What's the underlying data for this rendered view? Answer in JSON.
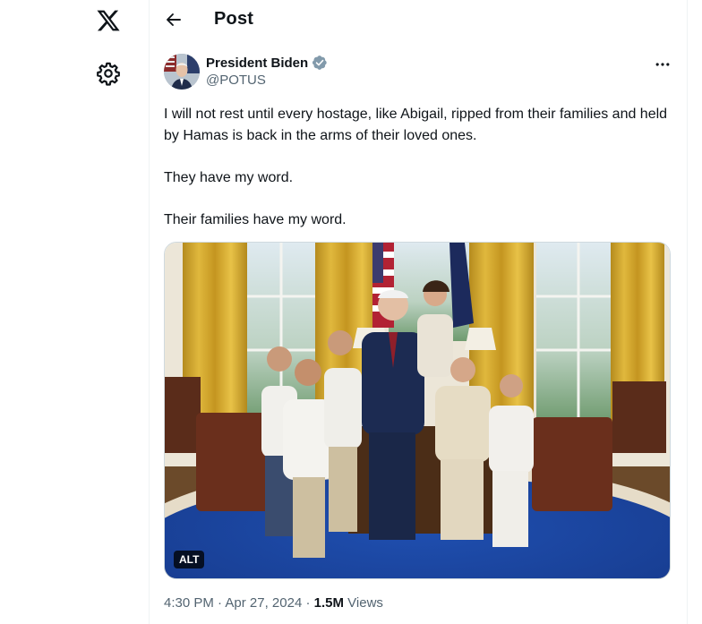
{
  "nav": {
    "logo_icon": "x-logo-icon",
    "settings_icon": "gear-icon"
  },
  "header": {
    "back_icon": "arrow-left-icon",
    "title": "Post"
  },
  "post": {
    "author_name": "President Biden",
    "verified_icon": "verified-badge-icon",
    "handle": "@POTUS",
    "more_icon": "more-horizontal-icon",
    "text_lines": [
      "I will not rest until every hostage, like Abigail, ripped from their families and held by Hamas is back in the arms of their loved ones.",
      "They have my word.",
      "Their families have my word."
    ],
    "media_alt_badge": "ALT",
    "time": "4:30 PM",
    "sep1": "·",
    "date": "Apr 27, 2024",
    "sep2": "·",
    "views_count": "1.5M",
    "views_label": "Views"
  },
  "colors": {
    "text": "#0f1419",
    "muted": "#536471",
    "verified": "#829aab",
    "border": "#eff3f4"
  }
}
